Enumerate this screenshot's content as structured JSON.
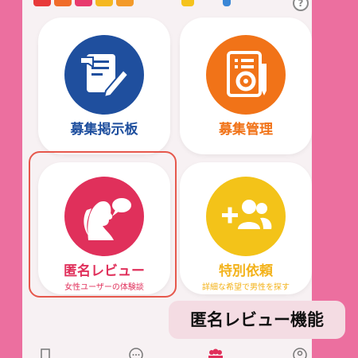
{
  "menu": {
    "recruit_board": {
      "label": "募集掲示板",
      "icon": "document-pen-icon",
      "color": "#1f4f9e"
    },
    "recruit_manage": {
      "label": "募集管理",
      "icon": "document-gear-icon",
      "color": "#f17318"
    },
    "anonymous_review": {
      "label": "匿名レビュー",
      "sub": "女性ユーザーの体験談",
      "icon": "woman-speech-icon",
      "color": "#e0305b"
    },
    "special_request": {
      "label": "特別依頼",
      "sub": "詳細な希望で男性を探す",
      "icon": "add-users-icon",
      "color": "#f3c319"
    }
  },
  "caption": "匿名レビュー機能",
  "highlight_color": "#e6584c",
  "accent_pink": "#ec6f9f"
}
